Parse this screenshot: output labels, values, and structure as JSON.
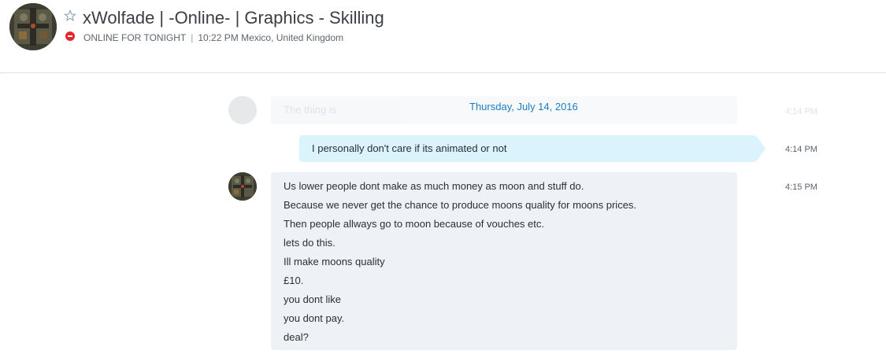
{
  "header": {
    "title": "xWolfade | -Online- | Graphics - Skilling",
    "mood": "ONLINE FOR TONIGHT",
    "local_time": "10:22 PM Mexico, United Kingdom",
    "status_color": "#e8262c"
  },
  "conversation": {
    "faded_message": {
      "text": "The thing is",
      "time": "4:14 PM"
    },
    "date_separator": "Thursday, July 14, 2016",
    "outgoing": {
      "text": "I personally don't care if its animated or not",
      "time": "4:14 PM"
    },
    "incoming": {
      "time": "4:15 PM",
      "lines": [
        "Us lower people dont make as much money as moon and stuff do.",
        "Because we never get the chance to produce moons quality for moons prices.",
        "Then people allways go to moon because of vouches etc.",
        "lets do this.",
        "Ill make moons quality",
        "£10.",
        "you dont like",
        "you dont pay.",
        "deal?"
      ]
    }
  },
  "colors": {
    "accent": "#1a7dc4",
    "outgoing_bubble": "#dbf3fd",
    "incoming_bubble": "#eef2f6"
  }
}
